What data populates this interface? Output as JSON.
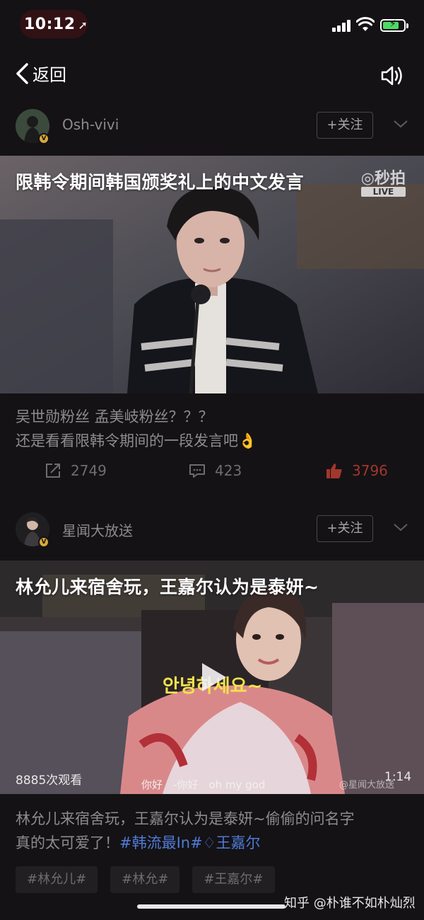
{
  "status_bar": {
    "time": "10:12"
  },
  "nav": {
    "back_label": "返回"
  },
  "posts": [
    {
      "author": "Osh-vivi",
      "follow_label": "+关注",
      "video_title": "限韩令期间韩国颁奖礼上的中文发言",
      "watermark": "秒拍",
      "watermark_live": "LIVE",
      "text_lines": [
        "吴世勋粉丝 孟美岐粉丝？？？",
        "还是看看限韩令期间的一段发言吧👌"
      ],
      "shares": "2749",
      "comments": "423",
      "likes": "3796"
    },
    {
      "author": "星闻大放送",
      "follow_label": "+关注",
      "video_title": "林允儿来宿舍玩，王嘉尔认为是泰妍~",
      "views": "8885次观看",
      "duration": "1:14",
      "subtitles": "你好　-你好　oh my god",
      "video_watermark": "@星闻大放送",
      "text_line1": "林允儿来宿舍玩，王嘉尔认为是泰妍~偷偷的问名字",
      "text_line2_plain": "真的太可爱了！",
      "hashtag1": "#韩流最In#",
      "hashtag2": "王嘉尔",
      "tags": [
        "#林允儿#",
        "#林允#",
        "#王嘉尔#"
      ]
    }
  ],
  "overlay_watermark": "知乎 @朴谁不如朴灿烈",
  "colors": {
    "background": "#141215",
    "like_accent": "#a3362d",
    "hashtag": "#4f7bd6",
    "battery": "#4cd964"
  }
}
